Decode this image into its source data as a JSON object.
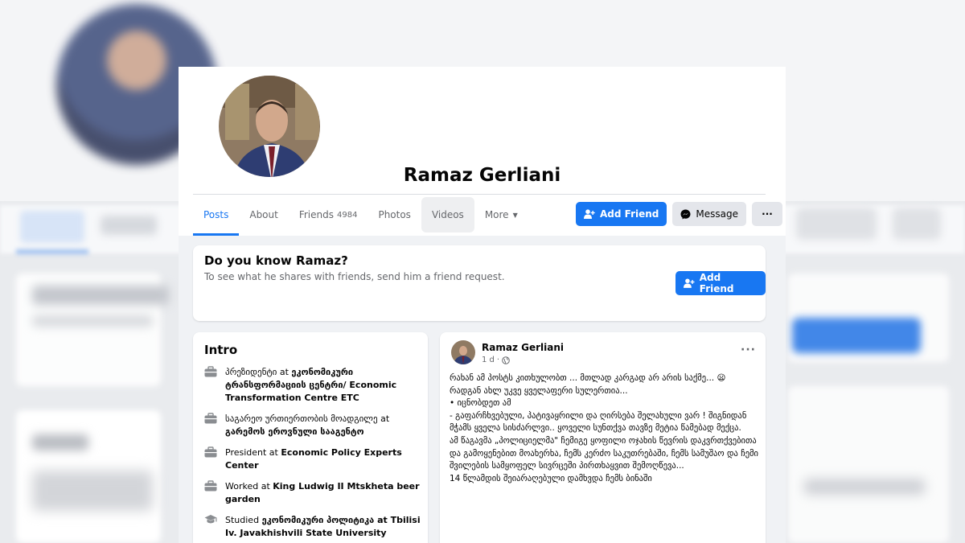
{
  "profile": {
    "name": "Ramaz Gerliani"
  },
  "tabs": [
    {
      "label": "Posts"
    },
    {
      "label": "About"
    },
    {
      "label": "Friends",
      "count": "4984"
    },
    {
      "label": "Photos"
    },
    {
      "label": "Videos"
    },
    {
      "label": "More"
    }
  ],
  "actions": {
    "add_friend": "Add Friend",
    "message": "Message",
    "more": "···"
  },
  "know": {
    "title": "Do you know Ramaz?",
    "subtitle": "To see what he shares with friends, send him a friend request.",
    "button": "Add Friend"
  },
  "intro": {
    "title": "Intro",
    "items": [
      {
        "icon": "briefcase-icon",
        "prefix": "პრეზიდენტი at ",
        "link": "ეკონომიკური ტრანსფორმაციის ცენტრი/ Economic Transformation Centre ETC"
      },
      {
        "icon": "briefcase-icon",
        "prefix": "საგარეო ურთიერთობის მოადგილე at ",
        "link": "გარემოს ეროვნული სააგენტო"
      },
      {
        "icon": "briefcase-icon",
        "prefix": "President at ",
        "link": "Economic Policy Experts Center"
      },
      {
        "icon": "briefcase-icon",
        "prefix": "Worked at ",
        "link": "King Ludwig II Mtskheta beer garden"
      },
      {
        "icon": "graduation-cap-icon",
        "prefix": "Studied ",
        "link": "ეკონომიკური პოლიტიკა at Tbilisi Iv. Javakhishvili State University"
      }
    ]
  },
  "post": {
    "author": "Ramaz Gerliani",
    "time": "1 d",
    "dots": "···",
    "body": "რახან ამ პოსტს კითხულობთ ... მთლად კარგად არ არის საქმე... 😦\n  რადგან ახლ უკვე ყველაფერი სულერთია...\n •  იცნობდეთ ამ\n- გაფარჩხვებული, პატივაყრილი და ღირსება შელახული ვარ ! შიგნიდან მჭამს ყველა სისძარლვი.. ყოველი სუნთქვა თავზე მეტია წამებად მექცა.\nამ წაგავმა „პოლიციელმა\" ჩემიგე ყოფილი ოჯახის წევრის დაკვრთქვებითა და გამოყენებით მოახერხა, ჩემს კერძო საკუთრებაში, ჩემს სამუშაო და ჩემი შვილების სამყოფელ სივრცეში პირთხაყვით შემოღწევა...\n14 წლამდის შეიარაღებული დამხვდა ჩემს ბინაში"
  }
}
